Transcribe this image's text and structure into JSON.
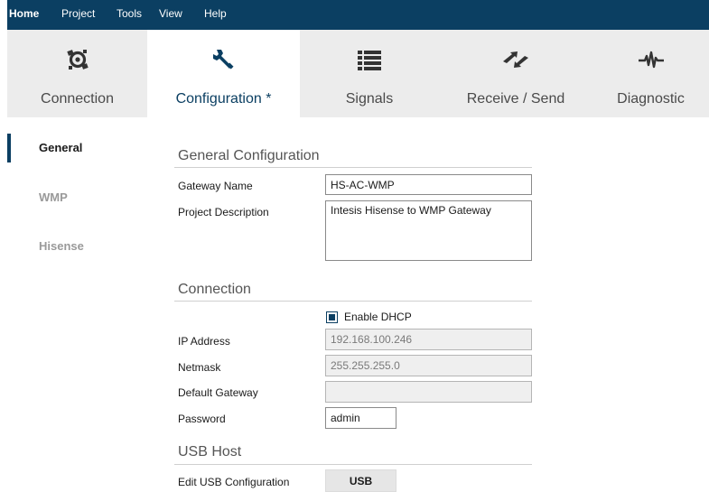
{
  "menu": {
    "items": [
      "Home",
      "Project",
      "Tools",
      "View",
      "Help"
    ]
  },
  "toolbar": {
    "tabs": [
      {
        "label": "Connection",
        "icon": "connection-icon"
      },
      {
        "label": "Configuration *",
        "icon": "wrench-icon"
      },
      {
        "label": "Signals",
        "icon": "list-icon"
      },
      {
        "label": "Receive / Send",
        "icon": "transfer-icon"
      },
      {
        "label": "Diagnostic",
        "icon": "pulse-icon"
      }
    ],
    "active_index": 1
  },
  "sidenav": {
    "items": [
      "General",
      "WMP",
      "Hisense"
    ],
    "active_index": 0
  },
  "general": {
    "title": "General Configuration",
    "gateway_name_label": "Gateway Name",
    "gateway_name_value": "HS-AC-WMP",
    "project_description_label": "Project Description",
    "project_description_value": "Intesis Hisense to WMP Gateway"
  },
  "connection": {
    "title": "Connection",
    "dhcp_label": "Enable DHCP",
    "dhcp_checked": true,
    "ip_label": "IP Address",
    "ip_value": "192.168.100.246",
    "netmask_label": "Netmask",
    "netmask_value": "255.255.255.0",
    "gateway_label": "Default Gateway",
    "gateway_value": "",
    "password_label": "Password",
    "password_value": "admin"
  },
  "usb": {
    "title": "USB Host",
    "edit_label": "Edit USB Configuration",
    "button_label": "USB"
  },
  "colors": {
    "brand": "#0b3f62",
    "toolbar_bg": "#ececec",
    "disabled_bg": "#efefef"
  }
}
